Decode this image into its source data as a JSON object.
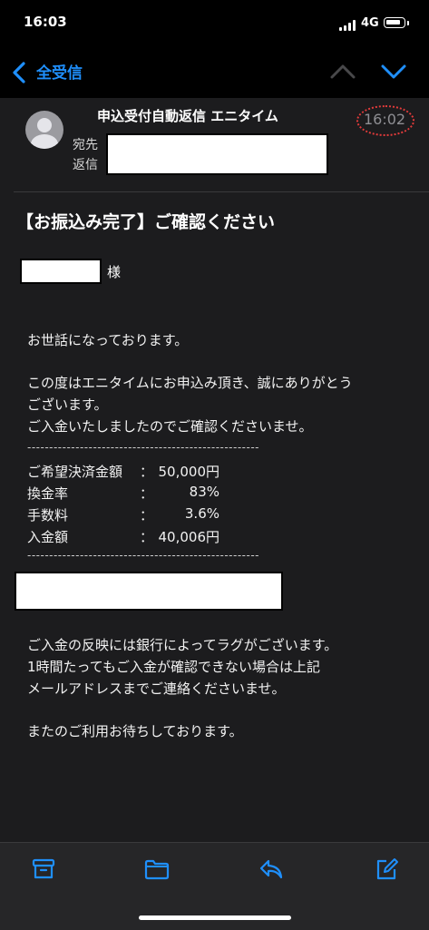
{
  "status": {
    "time": "16:03",
    "network": "4G"
  },
  "nav": {
    "back_label": "全受信"
  },
  "mail": {
    "sender": "申込受付自動返信 エニタイム",
    "time": "16:02",
    "to_label": "宛先",
    "reply_label": "返信"
  },
  "body": {
    "subject": "【お振込み完了】ご確認ください",
    "honorific": "様",
    "greeting": "お世話になっております。",
    "thanks_1": "この度はエニタイムにお申込み頂き、誠にありがとう",
    "thanks_2": "ございます。",
    "confirm": "ご入金いたしましたのでご確認くださいませ。",
    "separator": "-----------------------------------------------------",
    "rows": [
      {
        "key": "ご希望決済金額",
        "colon": "：",
        "value": "50,000円"
      },
      {
        "key": "換金率",
        "colon": "：",
        "value": "83%"
      },
      {
        "key": "手数料",
        "colon": "：",
        "value": "3.6%"
      },
      {
        "key": "入金額",
        "colon": "：",
        "value": "40,006円"
      }
    ],
    "notice_1": "ご入金の反映には銀行によってラグがございます。",
    "notice_2": "1時間たってもご入金が確認できない場合は上記",
    "notice_3": "メールアドレスまでご連絡くださいませ。",
    "closing": "またのご利用お待ちしております。"
  },
  "toolbar": {
    "icons": [
      "archive-icon",
      "folder-icon",
      "reply-icon",
      "compose-icon"
    ]
  },
  "colors": {
    "accent": "#1f8ffb",
    "highlight_ring": "#e33b3b",
    "background": "#1c1c1e"
  }
}
